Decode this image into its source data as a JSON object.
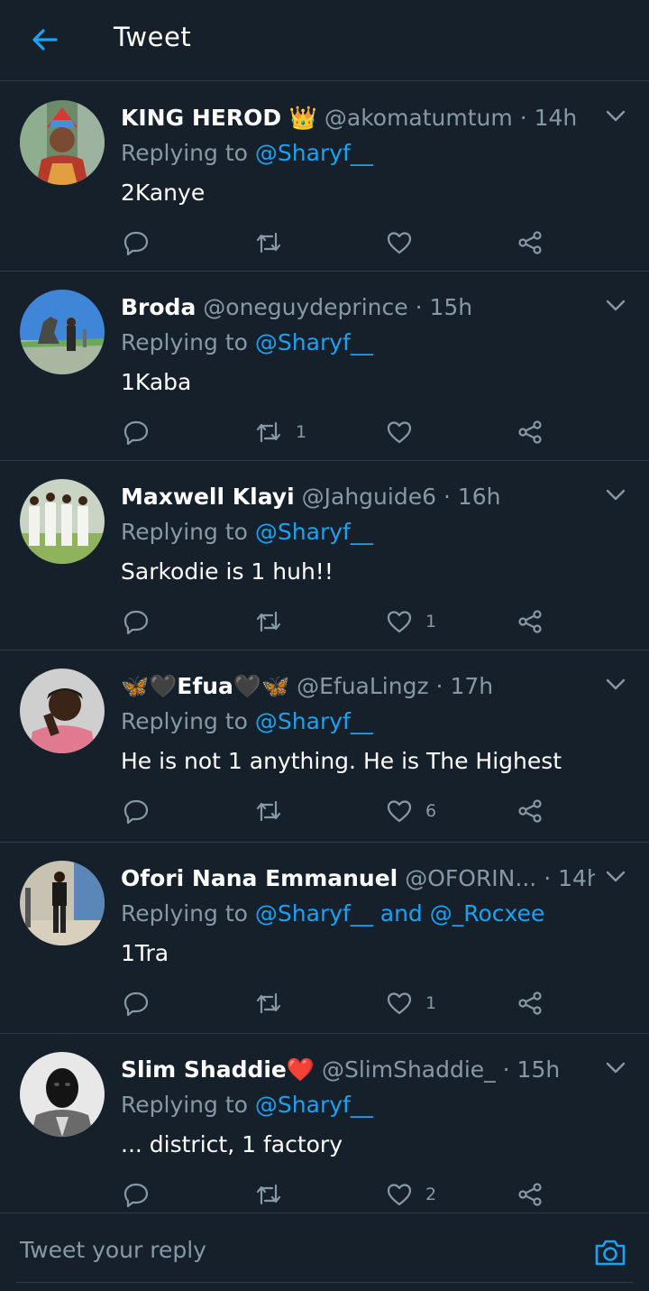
{
  "header": {
    "title": "Tweet",
    "back_icon": "arrow-left-icon"
  },
  "colors": {
    "background": "#15202b",
    "accent": "#1da1f2",
    "muted": "#8899a6",
    "divider": "#2f3b46",
    "heart": "#e0245e"
  },
  "tweets": [
    {
      "name": "KING HEROD 👑",
      "handle": "@akomatumtum",
      "time": "14h",
      "replying_prefix": "Replying to",
      "mentions": "@Sharyf__",
      "text": "2Kanye",
      "reply_count": "",
      "retweet_count": "",
      "like_count": ""
    },
    {
      "name": "Broda",
      "handle": "@oneguydeprince",
      "time": "15h",
      "replying_prefix": "Replying to",
      "mentions": "@Sharyf__",
      "text": "1Kaba",
      "reply_count": "",
      "retweet_count": "1",
      "like_count": ""
    },
    {
      "name": "Maxwell Klayi",
      "handle": "@Jahguide6",
      "time": "16h",
      "replying_prefix": "Replying to",
      "mentions": "@Sharyf__",
      "text": "Sarkodie is 1 huh!!",
      "reply_count": "",
      "retweet_count": "",
      "like_count": "1"
    },
    {
      "name": "🦋🖤Efua🖤🦋",
      "handle": "@EfuaLingz",
      "time": "17h",
      "replying_prefix": "Replying to",
      "mentions": "@Sharyf__",
      "text": "He is not 1 anything. He is The Highest",
      "reply_count": "",
      "retweet_count": "",
      "like_count": "6"
    },
    {
      "name": "Ofori Nana Emmanuel",
      "handle": "@OFORIN...",
      "time": "14h",
      "replying_prefix": "Replying to",
      "mentions": "@Sharyf__ and @_Rocxee",
      "text": "1Tra",
      "reply_count": "",
      "retweet_count": "",
      "like_count": "1"
    },
    {
      "name": "Slim Shaddie❤️",
      "handle": "@SlimShaddie_",
      "time": "15h",
      "replying_prefix": "Replying to",
      "mentions": "@Sharyf__",
      "text": "... district, 1 factory",
      "reply_count": "",
      "retweet_count": "",
      "like_count": "2"
    }
  ],
  "composer": {
    "placeholder": "Tweet your reply",
    "camera_icon": "camera-icon"
  }
}
